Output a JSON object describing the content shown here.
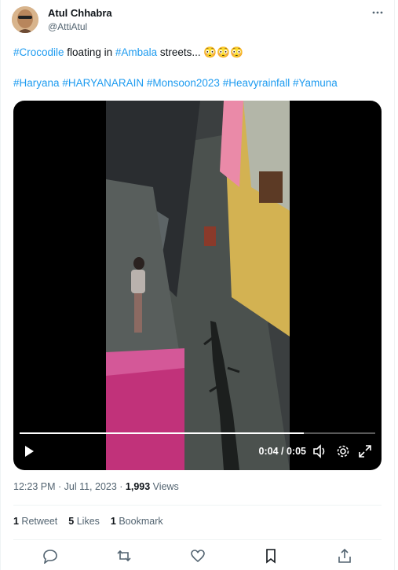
{
  "author": {
    "name": "Atul Chhabra",
    "handle": "@AttiAtul"
  },
  "tweet": {
    "line1": {
      "tag1": "#Crocodile",
      "t1": " floating in ",
      "tag2": "#Ambala",
      "t2": "  streets... ",
      "emoji": "😳😳😳"
    },
    "hashtags": [
      "#Haryana",
      "#HARYANARAIN",
      "#Monsoon2023",
      "#Heavyrainfall",
      "#Yamuna"
    ]
  },
  "video": {
    "time_label": "0:04 / 0:05",
    "progress": 0.8
  },
  "meta": {
    "time": "12:23 PM",
    "sep1": " · ",
    "date": "Jul 11, 2023",
    "sep2": " · ",
    "views_count": "1,993",
    "views_label": " Views"
  },
  "stats": [
    {
      "count": "1",
      "label": " Retweet"
    },
    {
      "count": "5",
      "label": " Likes"
    },
    {
      "count": "1",
      "label": " Bookmark"
    }
  ],
  "icons": {
    "more": "more-icon",
    "reply": "reply-icon",
    "retweet": "retweet-icon",
    "like": "heart-icon",
    "bookmark": "bookmark-icon",
    "share": "share-icon",
    "play": "play-icon",
    "volume": "volume-icon",
    "settings": "settings-icon",
    "fullscreen": "fullscreen-icon"
  },
  "colors": {
    "link": "#1d9bf0",
    "muted": "#536471",
    "text": "#0f1419"
  }
}
